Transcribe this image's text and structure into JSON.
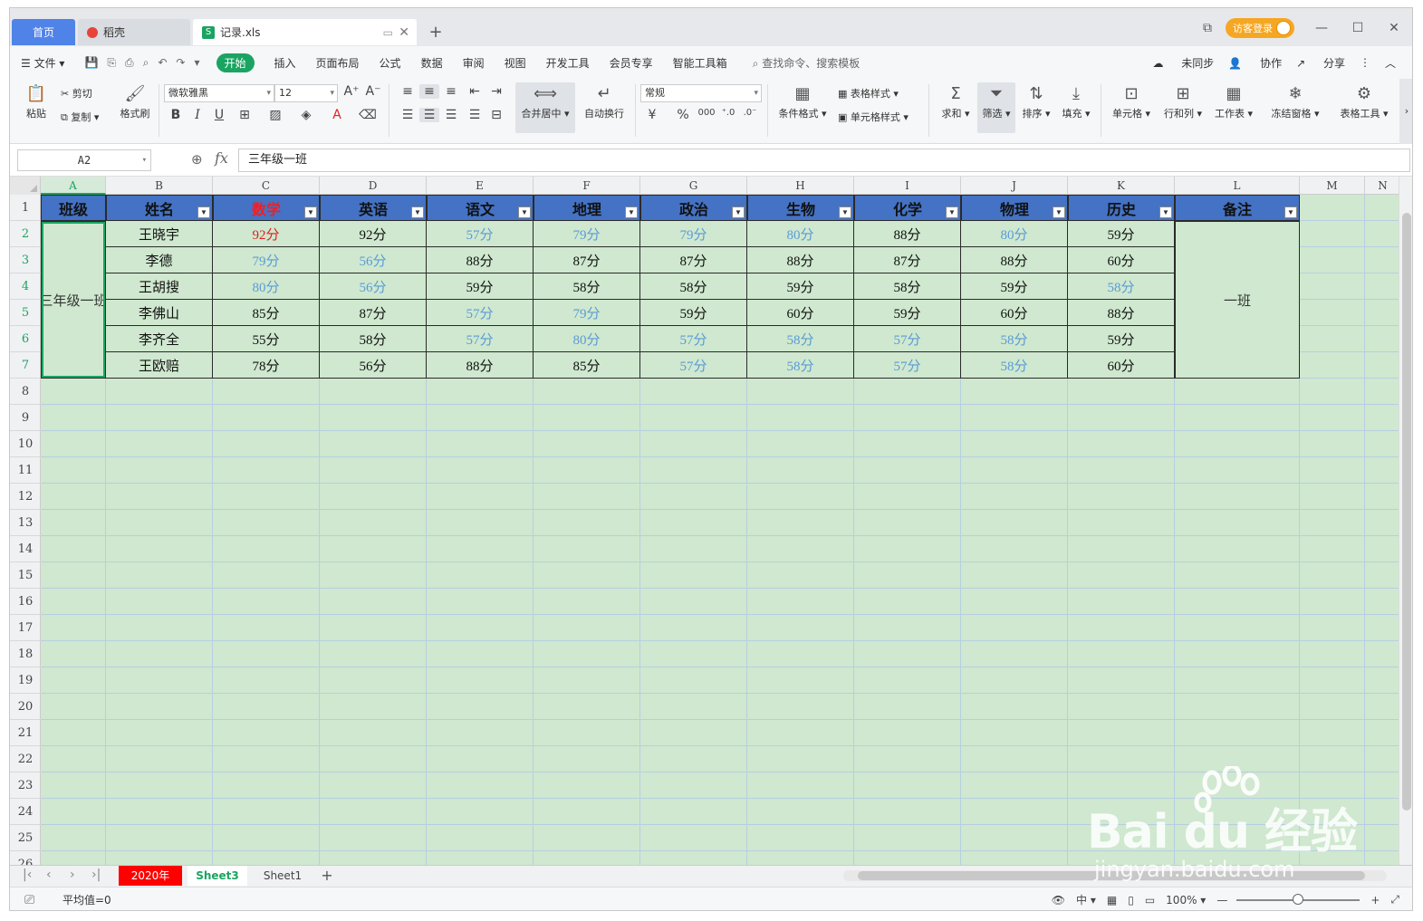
{
  "tabs": {
    "home": "首页",
    "shell": "稻壳",
    "file": "记录.xls",
    "file_icon": "S"
  },
  "window": {
    "login": "访客登录"
  },
  "menu": {
    "file": "文件",
    "items": [
      "开始",
      "插入",
      "页面布局",
      "公式",
      "数据",
      "审阅",
      "视图",
      "开发工具",
      "会员专享",
      "智能工具箱"
    ],
    "search": "查找命令、搜索模板",
    "right": [
      "未同步",
      "协作",
      "分享"
    ]
  },
  "ribbon": {
    "paste": "粘贴",
    "cut": "剪切",
    "copy": "复制",
    "format_painter": "格式刷",
    "font": "微软雅黑",
    "font_size": "12",
    "merge": "合并居中",
    "wrap": "自动换行",
    "number_format": "常规",
    "table_style": "表格样式",
    "cond_format": "条件格式",
    "cell_style": "单元格样式",
    "sum": "求和",
    "filter": "筛选",
    "sort": "排序",
    "fill": "填充",
    "cell": "单元格",
    "rowcol": "行和列",
    "sheet": "工作表",
    "freeze": "冻结窗格",
    "tabletool": "表格工具",
    "bold": "B",
    "italic": "I",
    "underline": "U",
    "currency": "¥",
    "percent": "%",
    "thousand": "000"
  },
  "formula": {
    "name_box": "A2",
    "fx": "fx",
    "content": "三年级一班"
  },
  "columns": [
    "A",
    "B",
    "C",
    "D",
    "E",
    "F",
    "G",
    "H",
    "I",
    "J",
    "K",
    "L",
    "M",
    "N"
  ],
  "rows": [
    "1",
    "2",
    "3",
    "4",
    "5",
    "6",
    "7",
    "8",
    "9",
    "10",
    "11",
    "12",
    "13",
    "14",
    "15",
    "16",
    "17",
    "18",
    "19",
    "20",
    "21",
    "22",
    "23",
    "24",
    "25",
    "26"
  ],
  "headers": [
    "班级",
    "姓名",
    "数学",
    "英语",
    "语文",
    "地理",
    "政治",
    "生物",
    "化学",
    "物理",
    "历史",
    "备注"
  ],
  "class_cell": "三年级一班",
  "note_cell": "一班",
  "data_rows": [
    {
      "name": "王晓宇",
      "scores": [
        "92分",
        "92分",
        "57分",
        "79分",
        "79分",
        "80分",
        "88分",
        "80分",
        "59分"
      ]
    },
    {
      "name": "李德",
      "scores": [
        "79分",
        "56分",
        "88分",
        "87分",
        "87分",
        "88分",
        "87分",
        "88分",
        "60分"
      ]
    },
    {
      "name": "王胡搜",
      "scores": [
        "80分",
        "56分",
        "59分",
        "58分",
        "58分",
        "59分",
        "58分",
        "59分",
        "58分"
      ]
    },
    {
      "name": "李佛山",
      "scores": [
        "85分",
        "87分",
        "57分",
        "79分",
        "59分",
        "60分",
        "59分",
        "60分",
        "88分"
      ]
    },
    {
      "name": "李齐全",
      "scores": [
        "55分",
        "58分",
        "57分",
        "80分",
        "57分",
        "58分",
        "57分",
        "58分",
        "59分"
      ]
    },
    {
      "name": "王欧赔",
      "scores": [
        "78分",
        "56分",
        "88分",
        "85分",
        "57分",
        "58分",
        "57分",
        "58分",
        "60分"
      ]
    }
  ],
  "colors": {
    "accent": "#1aa462",
    "header_bg": "#4472c4",
    "sheet_bg": "#cfe8cf",
    "low_score": "#5b9bd5",
    "high_score": "#e02020"
  },
  "sheets": [
    "2020年",
    "Sheet3",
    "Sheet1"
  ],
  "status": {
    "avg": "平均值=0",
    "zoom": "100%"
  },
  "watermark": {
    "text": "Bai  du 经验",
    "url": "jingyan.baidu.com"
  }
}
